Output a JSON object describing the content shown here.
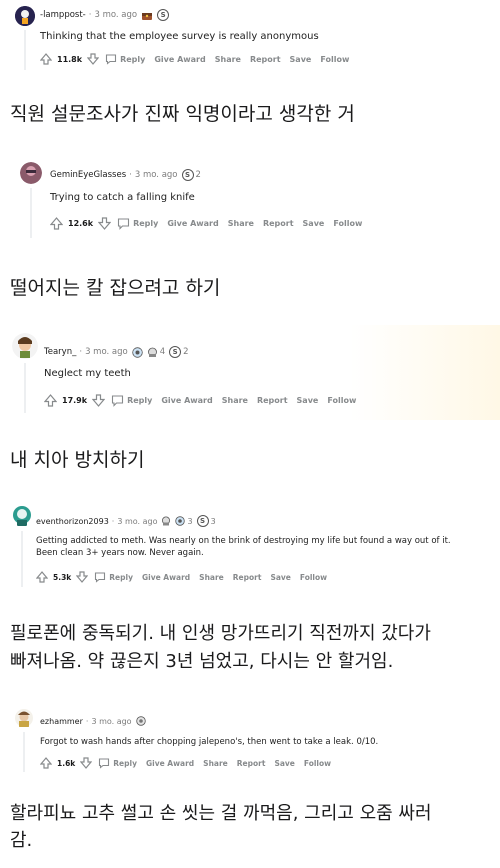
{
  "comments": [
    {
      "username": "-lamppost-",
      "time": "3 mo. ago",
      "awards": [
        {
          "icon": "treasure-chest-icon"
        },
        {
          "icon": "silver-coin-icon",
          "label": "S"
        }
      ],
      "text": "Thinking that the employee survey is really anonymous",
      "score": "11.8k",
      "actions": [
        "Reply",
        "Give Award",
        "Share",
        "Report",
        "Save",
        "Follow"
      ],
      "translation": "직원 설문조사가 진짜 익명이라고 생각한 거"
    },
    {
      "username": "GeminEyeGlasses",
      "time": "3 mo. ago",
      "awards": [
        {
          "icon": "silver-coin-icon",
          "label": "S",
          "count": "2"
        }
      ],
      "text": "Trying to catch a falling knife",
      "score": "12.6k",
      "actions": [
        "Reply",
        "Give Award",
        "Share",
        "Report",
        "Save",
        "Follow"
      ],
      "translation": "떨어지는 칼 잡으려고 하기"
    },
    {
      "username": "Tearyn_",
      "time": "3 mo. ago",
      "awards": [
        {
          "icon": "helpful-award-icon"
        },
        {
          "icon": "wholesome-award-icon",
          "count": "4"
        },
        {
          "icon": "silver-coin-icon",
          "label": "S",
          "count": "2"
        }
      ],
      "text": "Neglect my teeth",
      "score": "17.9k",
      "actions": [
        "Reply",
        "Give Award",
        "Share",
        "Report",
        "Save",
        "Follow"
      ],
      "translation": "내 치아 방치하기"
    },
    {
      "username": "eventhorizon2093",
      "time": "3 mo. ago",
      "awards": [
        {
          "icon": "wholesome-award-icon"
        },
        {
          "icon": "helpful-award-icon",
          "count": "3"
        },
        {
          "icon": "silver-coin-icon",
          "label": "S",
          "count": "3"
        }
      ],
      "text_lines": [
        "Getting addicted to meth. Was nearly on the brink of destroying my life but found a way out of it.",
        "Been clean 3+ years now. Never again."
      ],
      "score": "5.3k",
      "actions": [
        "Reply",
        "Give Award",
        "Share",
        "Report",
        "Save",
        "Follow"
      ],
      "translation_lines": [
        "필로폰에 중독되기. 내 인생 망가뜨리기 직전까지 갔다가",
        "빠져나옴. 약 끊은지 3년 넘었고, 다시는 안 할거임."
      ]
    },
    {
      "username": "ezhammer",
      "time": "3 mo. ago",
      "awards": [
        {
          "icon": "helpful-award-icon"
        }
      ],
      "text": "Forgot to wash hands after chopping jalepeno's, then went to take a leak. 0/10.",
      "score": "1.6k",
      "actions": [
        "Reply",
        "Give Award",
        "Share",
        "Report",
        "Save",
        "Follow"
      ],
      "translation_lines": [
        "할라피뇨 고추 썰고 손 씻는 걸 까먹음, 그리고 오줌 싸러",
        "감."
      ]
    }
  ],
  "colors": {
    "meta": "#7c7c7c",
    "action": "#878a8c",
    "thread_line": "#edeff1",
    "text": "#1a1a1b"
  }
}
